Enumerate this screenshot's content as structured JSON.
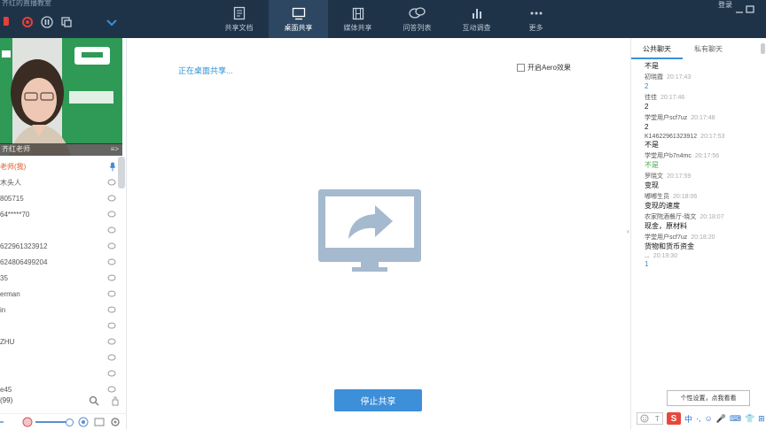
{
  "window": {
    "title": "齐红的直播教室",
    "login": "登录"
  },
  "toolbar": {
    "tabs": [
      {
        "label": "共享文档",
        "icon": "document-icon"
      },
      {
        "label": "桌面共享",
        "icon": "desktop-share-icon"
      },
      {
        "label": "媒体共享",
        "icon": "film-icon"
      },
      {
        "label": "问答列表",
        "icon": "chat-bubbles-icon"
      },
      {
        "label": "互动调查",
        "icon": "bar-chart-icon"
      },
      {
        "label": "更多",
        "icon": "more-icon"
      }
    ],
    "active_tab": 1
  },
  "video": {
    "caption": "齐红老师",
    "more": "≡>"
  },
  "users": {
    "teacher": "老师(我)",
    "list": [
      "木头人",
      "805715",
      "64*****70",
      "",
      "622961323912",
      "624806499204",
      "35",
      "erman",
      "in",
      "",
      "ZHU",
      "",
      "",
      "e45"
    ],
    "count_label": "(99)"
  },
  "main": {
    "status_text": "正在桌面共享...",
    "aero_label": "开启Aero效果",
    "stop_button": "停止共享"
  },
  "chat": {
    "tabs": [
      "公共聊天",
      "私有聊天"
    ],
    "messages": [
      {
        "name": "",
        "time": "",
        "text": "不是",
        "color": "dark"
      },
      {
        "name": "初晓霞",
        "time": "20:17:43",
        "text": "2",
        "color": "blue"
      },
      {
        "name": "佳佳",
        "time": "20:17:46",
        "text": "2",
        "color": "dark"
      },
      {
        "name": "学堂用户scf7uz",
        "time": "20:17:48",
        "text": "2",
        "color": "dark"
      },
      {
        "name": "K14622961323912",
        "time": "20:17:53",
        "text": "不是",
        "color": "dark"
      },
      {
        "name": "学堂用户b7n4mc",
        "time": "20:17:56",
        "text": "不是",
        "color": "green"
      },
      {
        "name": "罗晓文",
        "time": "20:17:59",
        "text": "变现",
        "color": "dark"
      },
      {
        "name": "嘟嘟生员",
        "time": "20:18:06",
        "text": "变现的速度",
        "color": "dark"
      },
      {
        "name": "农家院酒餐厅-晓文",
        "time": "20:18:07",
        "text": "现金，原材料",
        "color": "dark"
      },
      {
        "name": "学堂用户scf7uz",
        "time": "20:18:20",
        "text": "货物和货币资金",
        "color": "dark"
      },
      {
        "name": "...",
        "time": "20:19:30",
        "text": "1",
        "color": "blue"
      }
    ],
    "hint": "个性设置，点我看看",
    "ime": [
      "中",
      "·,",
      "☺",
      "🎤",
      "⌨",
      "👕",
      "⊞"
    ]
  },
  "colors": {
    "topbar": "#1f3348",
    "accent": "#3c8fd8",
    "teacher": "#e0592a",
    "record": "#e2423b"
  }
}
